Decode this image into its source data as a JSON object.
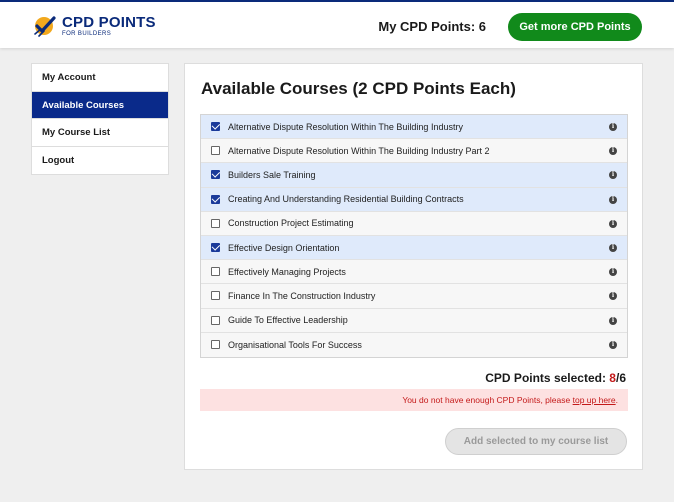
{
  "header": {
    "logo_title": "CPD POINTS",
    "logo_subtitle": "FOR BUILDERS",
    "my_points_label": "My CPD Points: 6",
    "get_more_label": "Get more CPD Points"
  },
  "sidebar": {
    "items": [
      {
        "label": "My Account",
        "active": false
      },
      {
        "label": "Available Courses",
        "active": true
      },
      {
        "label": "My Course List",
        "active": false
      },
      {
        "label": "Logout",
        "active": false
      }
    ]
  },
  "main": {
    "title": "Available Courses (2 CPD Points Each)",
    "courses": [
      {
        "name": "Alternative Dispute Resolution Within The Building Industry",
        "checked": true
      },
      {
        "name": "Alternative Dispute Resolution Within The Building Industry Part 2",
        "checked": false
      },
      {
        "name": "Builders Sale Training",
        "checked": true
      },
      {
        "name": "Creating And Understanding Residential Building Contracts",
        "checked": true
      },
      {
        "name": "Construction Project Estimating",
        "checked": false
      },
      {
        "name": "Effective Design Orientation",
        "checked": true
      },
      {
        "name": "Effectively Managing Projects",
        "checked": false
      },
      {
        "name": "Finance In The Construction Industry",
        "checked": false
      },
      {
        "name": "Guide To Effective Leadership",
        "checked": false
      },
      {
        "name": "Organisational Tools For Success",
        "checked": false
      }
    ],
    "info_glyph": "i",
    "selected_label": "CPD Points selected: ",
    "selected_value": "8",
    "selected_total": "/6",
    "alert_text": "You do not have enough CPD Points, please ",
    "alert_link": "top up here",
    "alert_end": ".",
    "add_button_label": "Add selected to my course list"
  },
  "colors": {
    "brand_navy": "#0a2a7a",
    "primary_green": "#118a1b",
    "error_red": "#c41a1a",
    "checked_row_bg": "#dfeafb"
  }
}
